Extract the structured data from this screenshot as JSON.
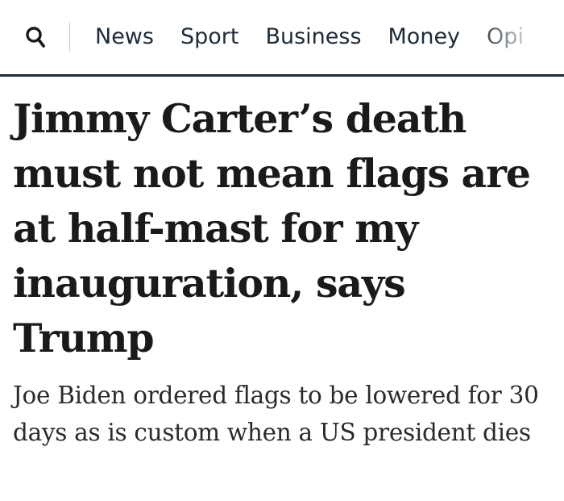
{
  "nav": {
    "search_icon": "search-icon",
    "items": [
      "News",
      "Sport",
      "Business",
      "Money",
      "Opi"
    ]
  },
  "article": {
    "headline": "Jimmy Carter’s death must not mean flags are at half-mast for my inauguration, says Trump",
    "standfirst": "Joe Biden ordered flags to be lowered for 30 days as is custom when a US president dies"
  },
  "colors": {
    "nav_text": "#1d2a38",
    "nav_rule": "#1d2a38",
    "headline": "#1a1a1a",
    "standfirst": "#2a2a2a"
  }
}
